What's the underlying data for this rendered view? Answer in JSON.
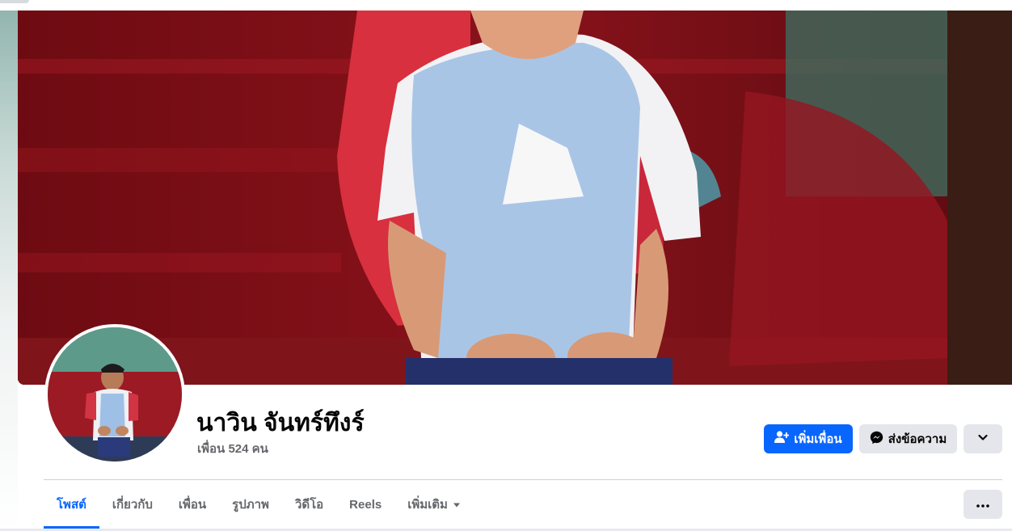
{
  "profile": {
    "name": "นาวิน จันทร์ทึงร์",
    "friends_text": "เพื่อน 524 คน"
  },
  "actions": {
    "add_friend_label": "เพิ่มเพื่อน",
    "message_label": "ส่งข้อความ"
  },
  "tabs": [
    {
      "label": "โพสต์",
      "active": true
    },
    {
      "label": "เกี่ยวกับ",
      "active": false
    },
    {
      "label": "เพื่อน",
      "active": false
    },
    {
      "label": "รูปภาพ",
      "active": false
    },
    {
      "label": "วิดีโอ",
      "active": false
    },
    {
      "label": "Reels",
      "active": false
    },
    {
      "label": "เพิ่มเติม",
      "active": false
    }
  ],
  "colors": {
    "accent": "#0866ff",
    "secondary_button": "#e4e6eb",
    "text_primary": "#050505",
    "text_secondary": "#65676b"
  },
  "icons": {
    "add_friend": "add-person-icon",
    "message": "messenger-icon",
    "dropdown": "chevron-down-icon",
    "more": "ellipsis-icon"
  }
}
